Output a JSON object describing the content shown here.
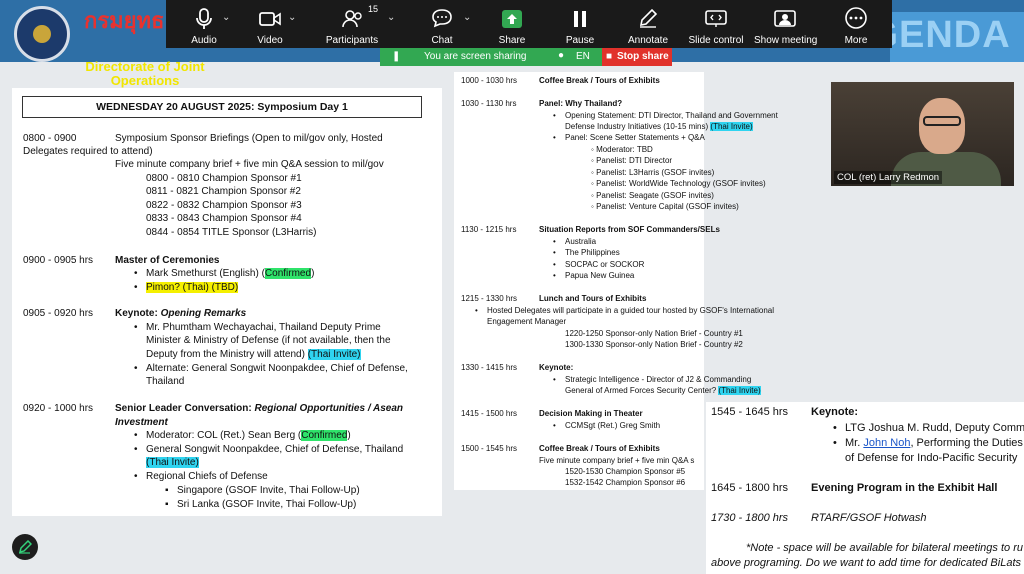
{
  "slide": {
    "thai_title": "กรมยุทธ ทหาร",
    "directorate": "Directorate of Joint Operations",
    "agenda_word": "AGENDA"
  },
  "toolbar": {
    "items": [
      {
        "label": "Audio",
        "icon": "microphone-icon"
      },
      {
        "label": "Video",
        "icon": "video-camera-icon"
      },
      {
        "label": "Participants",
        "icon": "participants-icon",
        "count": "15"
      },
      {
        "label": "Chat",
        "icon": "chat-icon"
      },
      {
        "label": "Share",
        "icon": "share-screen-icon"
      },
      {
        "label": "Pause",
        "icon": "pause-icon"
      },
      {
        "label": "Annotate",
        "icon": "annotate-pen-icon"
      },
      {
        "label": "Slide control",
        "icon": "slide-control-icon"
      },
      {
        "label": "Show meeting",
        "icon": "show-meeting-icon"
      },
      {
        "label": "More",
        "icon": "more-icon"
      }
    ],
    "sharing_status": "You are screen sharing",
    "language": "EN",
    "stop_share": "Stop share",
    "accent_share": "#32a852",
    "accent_stop": "#e1322b"
  },
  "left": {
    "day_header": "WEDNESDAY 20 AUGUST 2025: Symposium Day 1",
    "s1_time": "0800 - 0900",
    "s1_title": "Symposium Sponsor Briefings (Open to mil/gov only,  Hosted",
    "s1_title2": "Delegates required to attend)",
    "s1_note": "Five minute company brief + five min Q&A session to mil/gov",
    "s1_items": [
      "0800 - 0810 Champion Sponsor #1",
      "0811 - 0821 Champion Sponsor #2",
      "0822 - 0832 Champion Sponsor #3",
      "0833 - 0843 Champion Sponsor #4",
      "0844 - 0854 TITLE Sponsor (L3Harris)"
    ],
    "s2_time": "0900 - 0905 hrs",
    "s2_title": "Master of Ceremonies",
    "s2_b1": "Mark Smethurst (English)  (",
    "s2_b1_hl": "Confirmed",
    "s2_b1_end": ")",
    "s2_b2": "Pimon? (Thai) (TBD)",
    "s3_time": "0905 - 0920 hrs",
    "s3_title": "Keynote: ",
    "s3_title_it": "Opening Remarks",
    "s3_b1_l1": "Mr. Phumtham Wechayachai, Thailand Deputy Prime",
    "s3_b1_l2": "Minister & Ministry of Defense (if not available, then the",
    "s3_b1_l3": "Deputy from the Ministry will attend) ",
    "s3_b1_hl": "(Thai Invite)",
    "s3_b2_l1": "Alternate: General Songwit Noonpakdee, Chief of Defense,",
    "s3_b2_l2": "Thailand",
    "s4_time": "0920 - 1000 hrs",
    "s4_title": "Senior Leader Conversation: ",
    "s4_title_it": "Regional Opportunities / Asean",
    "s4_title_it2": "Investment",
    "s4_b1": "Moderator: COL (Ret.) Sean Berg (",
    "s4_b1_hl": "Confirmed",
    "s4_b1_end": ")",
    "s4_b2": "General Songwit Noonpakdee, Chief of Defense, Thailand",
    "s4_b2_hl": "(Thai Invite)",
    "s4_b3": "Regional Chiefs of Defense",
    "s4_sub1": "Singapore (GSOF Invite, Thai Follow-Up)",
    "s4_sub2": "Sri Lanka (GSOF Invite, Thai Follow-Up)"
  },
  "mid": {
    "r1_time": "1000 - 1030 hrs",
    "r1_title": "Coffee Break / Tours of Exhibits",
    "r2_time": "1030 - 1130 hrs",
    "r2_title": "Panel: Why Thailand?",
    "r2_b1": "Opening Statement: DTI Director, Thailand and Government",
    "r2_b1b": "Defense Industry Initiatives (10-15 mins) ",
    "r2_b1_hl": "(Thai Invite)",
    "r2_b2": "Panel: Scene Setter Statements + Q&A",
    "r2_subs": [
      "Moderator: TBD",
      "Panelist: DTI Director",
      "Panelist: L3Harris (GSOF invites)",
      "Panelist: WorldWide Technology (GSOF invites)",
      "Panelist: Seagate (GSOF invites)",
      "Panelist: Venture Capital (GSOF invites)"
    ],
    "r3_time": "1130 - 1215 hrs",
    "r3_title": "Situation Reports from SOF Commanders/SELs",
    "r3_items": [
      "Australia",
      "The Philippines",
      "SOCPAC or SOCKOR",
      "Papua New Guinea"
    ],
    "r4_time": "1215 - 1330 hrs",
    "r4_title": "Lunch and Tours of Exhibits",
    "r4_b1": "Hosted Delegates will participate in a guided tour hosted by GSOF's International",
    "r4_b1b": "Engagement Manager",
    "r4_l1": "1220-1250    Sponsor-only Nation Brief - Country #1",
    "r4_l2": "1300-1330    Sponsor-only Nation Brief - Country #2",
    "r5_time": "1330 - 1415 hrs",
    "r5_title": "Keynote:",
    "r5_b1": "Strategic Intelligence - Director of J2 & Commanding",
    "r5_b1b": "General of Armed Forces Security Center? ",
    "r5_b1_hl": "(Thai Invite)",
    "r6_time": "1415 - 1500 hrs",
    "r6_title": "Decision Making in Theater",
    "r6_b1": "CCMSgt (Ret.) Greg Smith",
    "r7_time": "1500 - 1545 hrs",
    "r7_title": "Coffee Break / Tours of Exhibits",
    "r7_note": "Five minute company brief + five min Q&A s",
    "r7_l1": "1520-1530 Champion Sponsor #5",
    "r7_l2": "1532-1542 Champion Sponsor #6"
  },
  "right": {
    "t1_time": "1545 - 1645 hrs",
    "t1_title": "Keynote:",
    "t1_b1": "LTG Joshua M. Rudd, Deputy Comm",
    "t1_b2_pre": "Mr. ",
    "t1_b2_link": "John Noh",
    "t1_b2_post": ", Performing the Duties",
    "t1_b2_l2": "of Defense for Indo-Pacific Security",
    "t2_time": "1645 - 1800 hrs",
    "t2_title": "Evening Program in the Exhibit Hall",
    "t3_time": "1730 - 1800 hrs",
    "t3_title": "RTARF/GSOF Hotwash",
    "note_l1": "*Note - space will be available for bilateral meetings to ru",
    "note_l2": "above programing. Do we want to add time for dedicated BiLats"
  },
  "video": {
    "participant_name": "COL (ret) Larry Redmon"
  }
}
